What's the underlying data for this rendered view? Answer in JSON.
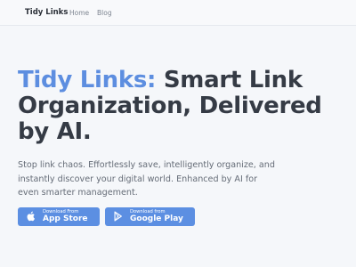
{
  "nav": {
    "brand": "Tidy Links",
    "links": [
      {
        "label": "Home"
      },
      {
        "label": "Blog"
      }
    ]
  },
  "hero": {
    "title_accent": "Tidy Links:",
    "title_rest": " Smart Link Organization, Delivered by AI.",
    "description": "Stop link chaos. Effortlessly save, intelligently organize, and instantly discover your digital world. Enhanced by AI for even smarter management."
  },
  "buttons": {
    "app_store": {
      "small": "Download From",
      "large": "App Store",
      "icon": "apple-icon"
    },
    "google_play": {
      "small": "Download from",
      "large": "Google Play",
      "icon": "play-icon"
    }
  },
  "colors": {
    "accent": "#5d8ee0",
    "button": "#5c8fe2",
    "background": "#f5f7fa",
    "title": "#353b45"
  }
}
